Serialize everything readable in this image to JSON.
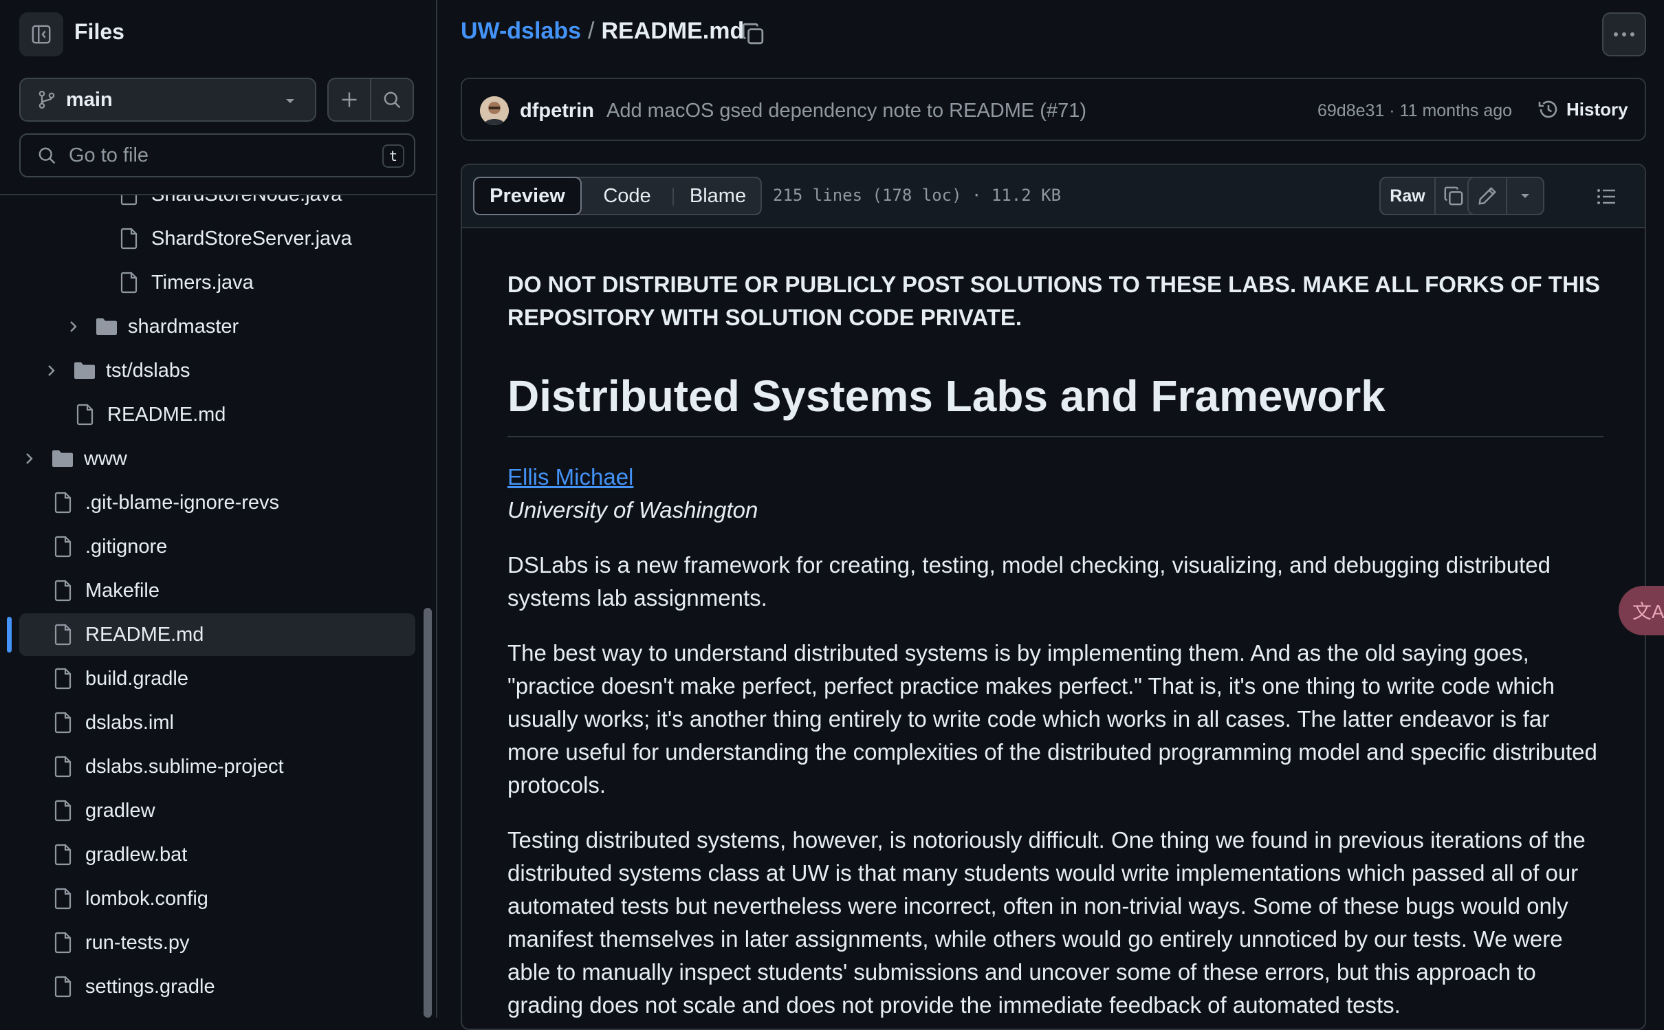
{
  "sidebar": {
    "title": "Files",
    "branch": "main",
    "goto_placeholder": "Go to file",
    "goto_shortcut": "t",
    "tree": [
      {
        "label": "ShardStoreNode.java",
        "type": "file",
        "depth": 3
      },
      {
        "label": "ShardStoreServer.java",
        "type": "file",
        "depth": 3
      },
      {
        "label": "Timers.java",
        "type": "file",
        "depth": 3
      },
      {
        "label": "shardmaster",
        "type": "folder",
        "depth": 2
      },
      {
        "label": "tst/dslabs",
        "type": "folder",
        "depth": 1
      },
      {
        "label": "README.md",
        "type": "file",
        "depth": 1
      },
      {
        "label": "www",
        "type": "folder",
        "depth": 0
      },
      {
        "label": ".git-blame-ignore-revs",
        "type": "file",
        "depth": 0
      },
      {
        "label": ".gitignore",
        "type": "file",
        "depth": 0
      },
      {
        "label": "Makefile",
        "type": "file",
        "depth": 0
      },
      {
        "label": "README.md",
        "type": "file",
        "depth": 0,
        "active": true
      },
      {
        "label": "build.gradle",
        "type": "file",
        "depth": 0
      },
      {
        "label": "dslabs.iml",
        "type": "file",
        "depth": 0
      },
      {
        "label": "dslabs.sublime-project",
        "type": "file",
        "depth": 0
      },
      {
        "label": "gradlew",
        "type": "file",
        "depth": 0
      },
      {
        "label": "gradlew.bat",
        "type": "file",
        "depth": 0
      },
      {
        "label": "lombok.config",
        "type": "file",
        "depth": 0
      },
      {
        "label": "run-tests.py",
        "type": "file",
        "depth": 0
      },
      {
        "label": "settings.gradle",
        "type": "file",
        "depth": 0
      }
    ]
  },
  "header": {
    "repo": "UW-dslabs",
    "separator": "/",
    "file": "README.md"
  },
  "commit": {
    "author": "dfpetrin",
    "message": "Add macOS gsed dependency note to README (#71)",
    "meta": "69d8e31 · 11 months ago",
    "history_label": "History"
  },
  "toolbar": {
    "tabs": [
      "Preview",
      "Code",
      "Blame"
    ],
    "active_tab": "Preview",
    "file_info": "215 lines (178 loc) · 11.2 KB",
    "raw_label": "Raw"
  },
  "readme": {
    "warning": "DO NOT DISTRIBUTE OR PUBLICLY POST SOLUTIONS TO THESE LABS. MAKE ALL FORKS OF THIS REPOSITORY WITH SOLUTION CODE PRIVATE.",
    "title": "Distributed Systems Labs and Framework",
    "author": "Ellis Michael",
    "affiliation": "University of Washington",
    "paragraphs": [
      "DSLabs is a new framework for creating, testing, model checking, visualizing, and debugging distributed systems lab assignments.",
      "The best way to understand distributed systems is by implementing them. And as the old saying goes, \"practice doesn't make perfect, perfect practice makes perfect.\" That is, it's one thing to write code which usually works; it's another thing entirely to write code which works in all cases. The latter endeavor is far more useful for understanding the complexities of the distributed programming model and specific distributed protocols.",
      "Testing distributed systems, however, is notoriously difficult. One thing we found in previous iterations of the distributed systems class at UW is that many students would write implementations which passed all of our automated tests but nevertheless were incorrect, often in non-trivial ways. Some of these bugs would only manifest themselves in later assignments, while others would go entirely unnoticed by our tests. We were able to manually inspect students' submissions and uncover some of these errors, but this approach to grading does not scale and does not provide the immediate feedback of automated tests."
    ]
  },
  "translate_fab": "文A",
  "colors": {
    "background": "#0d1117",
    "link": "#4493f8",
    "muted": "#9198a1",
    "border": "#30363d",
    "active_indicator": "#4493f8"
  }
}
